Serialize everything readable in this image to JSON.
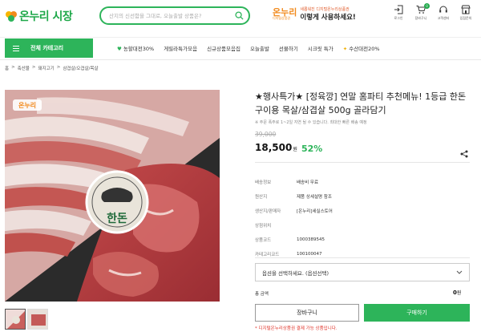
{
  "header": {
    "logo_text": "온누리 시장",
    "search_placeholder": "산지의 신선함을 그대로, 오늘출발 상품은?",
    "promo_logo": "온누리",
    "promo_logo_sub": "디지털상품권",
    "promo_line1": "새롭워진 디지털온누리상품권",
    "promo_line2": "이렇게 사용하세요!",
    "icons": [
      {
        "label": "로그인",
        "icon": "login-icon"
      },
      {
        "label": "장바구니",
        "icon": "cart-icon",
        "badge": "0"
      },
      {
        "label": "고객센터",
        "icon": "headset-icon"
      },
      {
        "label": "입점문의",
        "icon": "store-icon"
      }
    ]
  },
  "nav": {
    "category_label": "전체 카테고리",
    "menu": [
      "농할대전30%",
      "게릴라특가모음",
      "신규상품모음집",
      "오늘출발",
      "선물하기",
      "시크릿 특가",
      "수산대전20%"
    ]
  },
  "breadcrumb": [
    "홈",
    "축산물",
    "돼지고기",
    "삼겹살/오겹살/목살"
  ],
  "image": {
    "stamp_logo": "온누리",
    "label_text": "한돈"
  },
  "product": {
    "title": "★행사특가★ [정육깡] 연말 홈파티 추천메뉴! 1등급 한돈 구이용 목살/삼겹살 500g 골라담기",
    "subnote": "※ 주문 폭주로 1~2일 지연 될 수 있습니다. 최대한 빠른 배송 예정",
    "original_price": "39,000",
    "price": "18,500",
    "price_unit": "원",
    "discount": "52%",
    "info": [
      {
        "k": "배송정보",
        "v": "배송비 무료"
      },
      {
        "k": "원산지",
        "v": "제품 상세설명 참조"
      },
      {
        "k": "생산지/판매자",
        "v": "[온누리]세실스토어"
      },
      {
        "k": "상점위치",
        "v": ""
      },
      {
        "k": "상품코드",
        "v": "1000389545"
      },
      {
        "k": "카테고리코드",
        "v": "100100047"
      }
    ],
    "option_select": "옵션을 선택하세요. (옵션선택)",
    "total_label": "총 금액",
    "total_value": "0",
    "total_unit": "원",
    "cart_button": "장바구니",
    "buy_button": "구매하기",
    "notice": "* 디지털온누리상품권 결제 가능 상품입니다."
  },
  "colors": {
    "brand": "#2db45a",
    "accent": "#f28a1c",
    "alert": "#e0342a"
  }
}
